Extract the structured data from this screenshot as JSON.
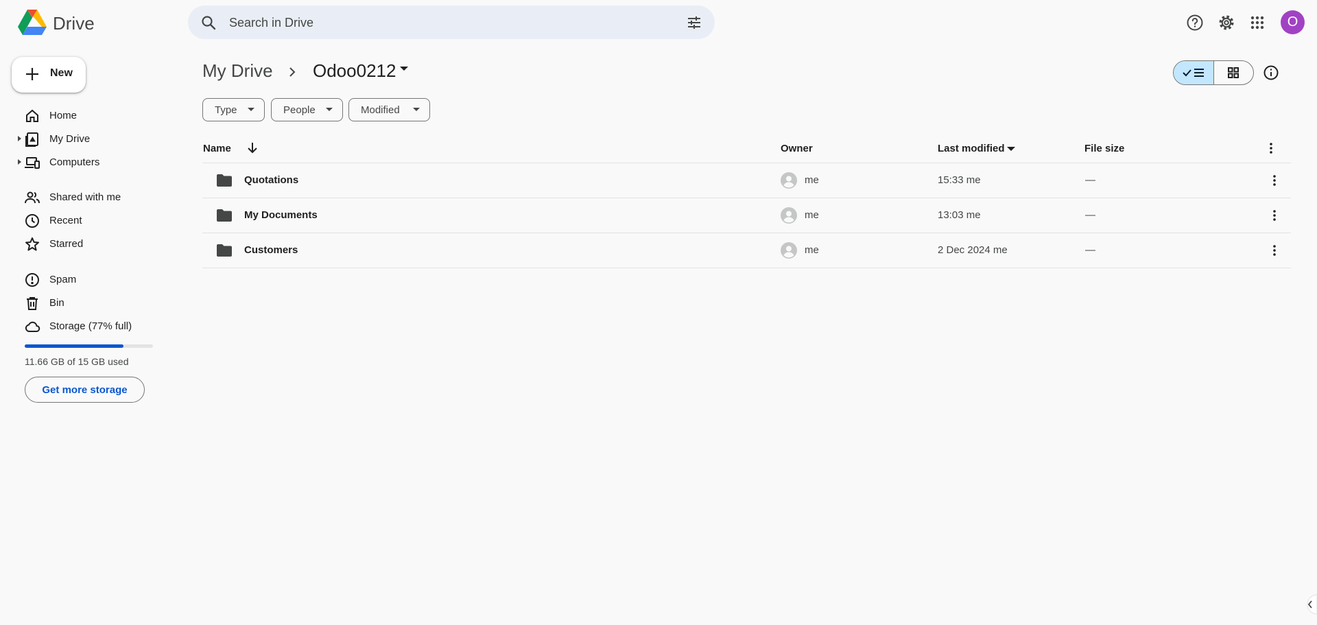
{
  "app": {
    "name": "Drive"
  },
  "search": {
    "placeholder": "Search in Drive"
  },
  "header": {
    "avatar_letter": "O"
  },
  "sidebar": {
    "new_label": "New",
    "items": [
      {
        "label": "Home",
        "icon": "home-icon"
      },
      {
        "label": "My Drive",
        "icon": "my-drive-icon"
      },
      {
        "label": "Computers",
        "icon": "computers-icon"
      },
      {
        "label": "Shared with me",
        "icon": "shared-icon"
      },
      {
        "label": "Recent",
        "icon": "clock-icon"
      },
      {
        "label": "Starred",
        "icon": "star-icon"
      },
      {
        "label": "Spam",
        "icon": "spam-icon"
      },
      {
        "label": "Bin",
        "icon": "bin-icon"
      },
      {
        "label": "Storage (77% full)",
        "icon": "cloud-icon"
      }
    ],
    "storage_fraction": 0.77,
    "storage_text": "11.66 GB of 15 GB used",
    "get_more_storage": "Get more storage"
  },
  "breadcrumb": {
    "root": "My Drive",
    "current": "Odoo0212"
  },
  "filters": [
    "Type",
    "People",
    "Modified"
  ],
  "columns": {
    "name": "Name",
    "owner": "Owner",
    "modified": "Last modified",
    "size": "File size"
  },
  "files": [
    {
      "name": "Quotations",
      "owner": "me",
      "modified": "15:33 me",
      "size": "—"
    },
    {
      "name": "My Documents",
      "owner": "me",
      "modified": "13:03 me",
      "size": "—"
    },
    {
      "name": "Customers",
      "owner": "me",
      "modified": "2 Dec 2024 me",
      "size": "—"
    }
  ],
  "colors": {
    "accent": "#0b57d0",
    "avatar": "#a142c4",
    "search_bg": "#e9eef6",
    "view_active": "#c2e7ff"
  }
}
